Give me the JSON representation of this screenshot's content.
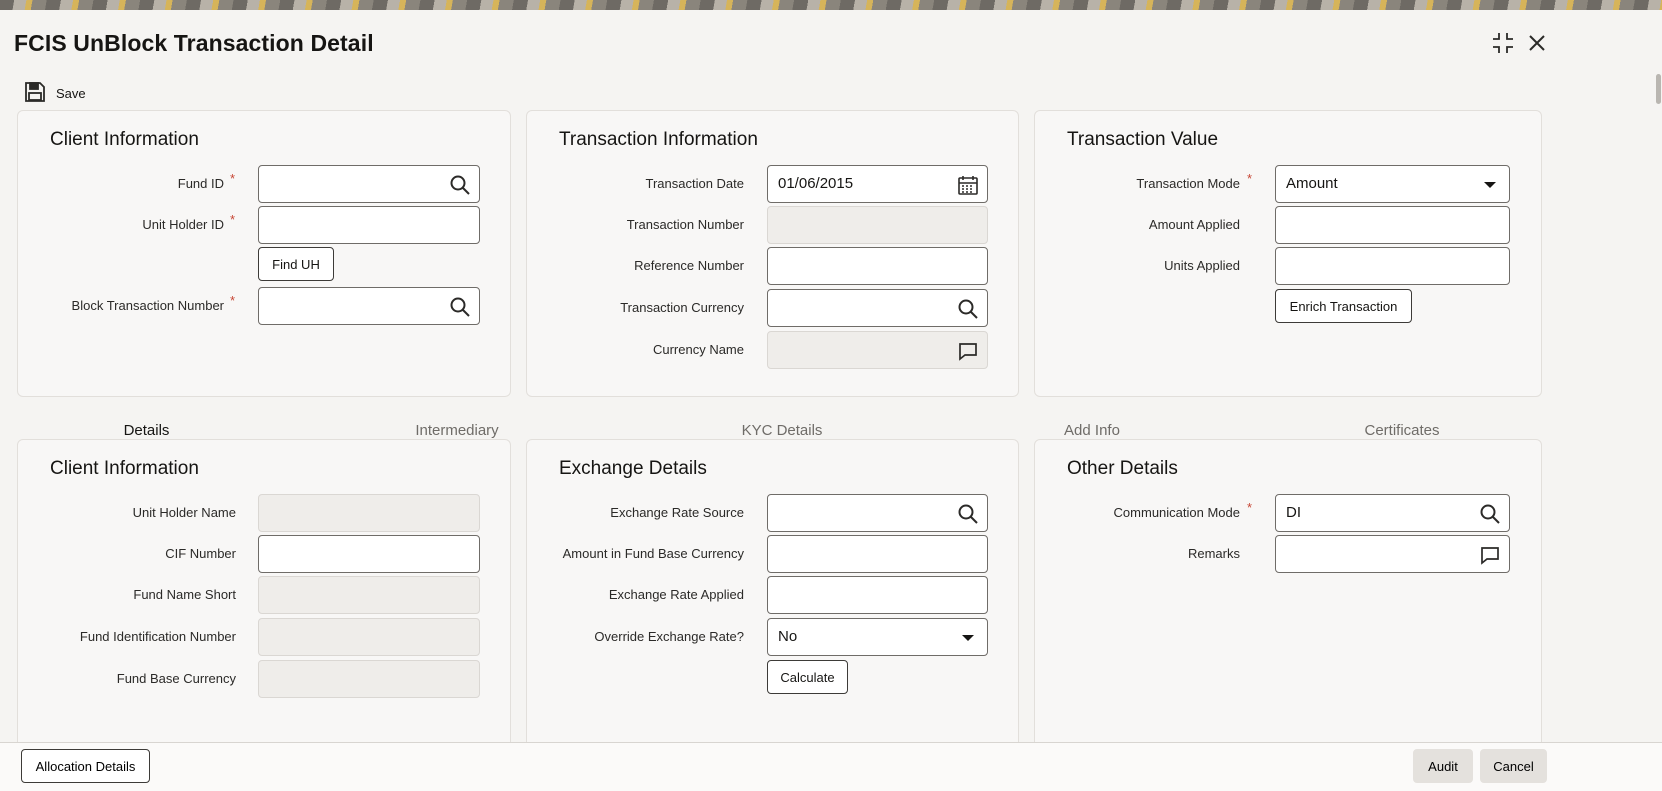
{
  "window": {
    "title": "FCIS UnBlock Transaction Detail"
  },
  "toolbar": {
    "save_label": "Save"
  },
  "client_info_panel": {
    "title": "Client Information",
    "fund_id_label": "Fund ID",
    "unit_holder_id_label": "Unit Holder ID",
    "find_uh_label": "Find UH",
    "block_txn_label": "Block Transaction Number"
  },
  "transaction_info_panel": {
    "title": "Transaction Information",
    "txn_date_label": "Transaction Date",
    "txn_date_value": "01/06/2015",
    "txn_number_label": "Transaction Number",
    "reference_number_label": "Reference Number",
    "txn_currency_label": "Transaction Currency",
    "currency_name_label": "Currency Name"
  },
  "transaction_value_panel": {
    "title": "Transaction Value",
    "mode_label": "Transaction Mode",
    "mode_value": "Amount",
    "amount_applied_label": "Amount Applied",
    "units_applied_label": "Units Applied",
    "enrich_label": "Enrich Transaction"
  },
  "tabs": [
    {
      "label": "Details"
    },
    {
      "label": "Intermediary"
    },
    {
      "label": "KYC Details"
    },
    {
      "label": "Add Info"
    },
    {
      "label": "Certificates"
    }
  ],
  "details_client_panel": {
    "title": "Client Information",
    "unit_holder_name_label": "Unit Holder Name",
    "cif_label": "CIF Number",
    "fund_name_short_label": "Fund Name Short",
    "fund_ident_label": "Fund Identification Number",
    "fund_base_currency_label": "Fund Base Currency"
  },
  "exchange_panel": {
    "title": "Exchange Details",
    "rate_source_label": "Exchange Rate Source",
    "amount_fund_base_label": "Amount in Fund Base Currency",
    "rate_applied_label": "Exchange Rate Applied",
    "override_label": "Override Exchange Rate?",
    "override_value": "No",
    "calculate_label": "Calculate"
  },
  "other_panel": {
    "title": "Other Details",
    "comm_mode_label": "Communication Mode",
    "comm_mode_value": "DI",
    "remarks_label": "Remarks"
  },
  "footer": {
    "allocation_label": "Allocation Details",
    "audit_label": "Audit",
    "cancel_label": "Cancel"
  },
  "colors": {
    "required": "#c74634",
    "tab_active": "#5b5a75",
    "panel_bg": "#f8f7f6"
  }
}
